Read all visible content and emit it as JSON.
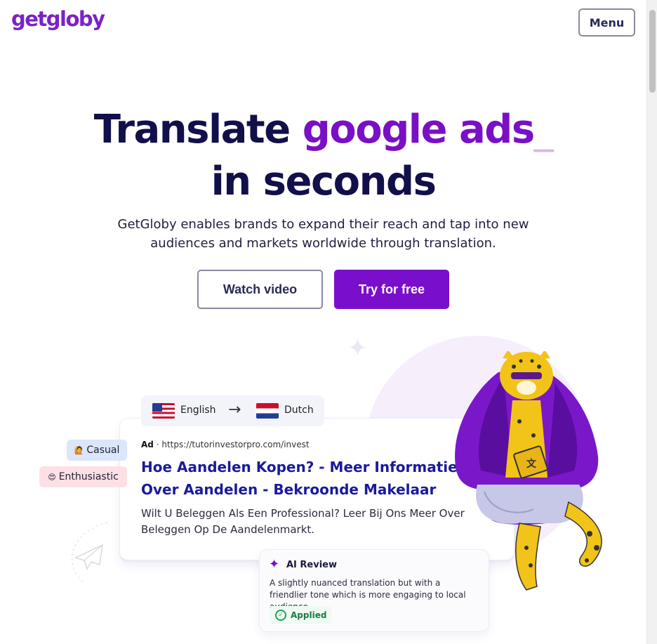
{
  "header": {
    "logo": "getgloby",
    "menu_label": "Menu"
  },
  "hero": {
    "title_prefix": "Translate",
    "title_accent": "google ads",
    "title_cursor": "_",
    "title_line2": "in seconds",
    "subtitle": "GetGloby enables brands to expand their reach and tap into new audiences and markets worldwide through translation.",
    "watch_label": "Watch video",
    "try_label": "Try for free"
  },
  "demo": {
    "lang_from": "English",
    "lang_to": "Dutch",
    "arrow": "→",
    "tags": [
      {
        "emoji": "🙋",
        "label": "Casual"
      },
      {
        "emoji": "😍",
        "label": "Enthusiastic"
      }
    ],
    "ad": {
      "badge": "Ad",
      "url": "https://tutorinvestorpro.com/invest",
      "title": "Hoe Aandelen Kopen? - Meer Informatie Over Aandelen - Bekroonde Makelaar",
      "description": "Wilt U Beleggen Als Een Professional? Leer Bij Ons Meer Over Beleggen Op De Aandelenmarkt."
    },
    "review": {
      "title": "AI Review",
      "body": "A slightly nuanced translation but with a friendlier tone which is more engaging to local audience.",
      "status": "Applied"
    }
  },
  "colors": {
    "brand": "#7a10c4",
    "ink": "#11104a",
    "ad_title": "#1a1a9c"
  }
}
